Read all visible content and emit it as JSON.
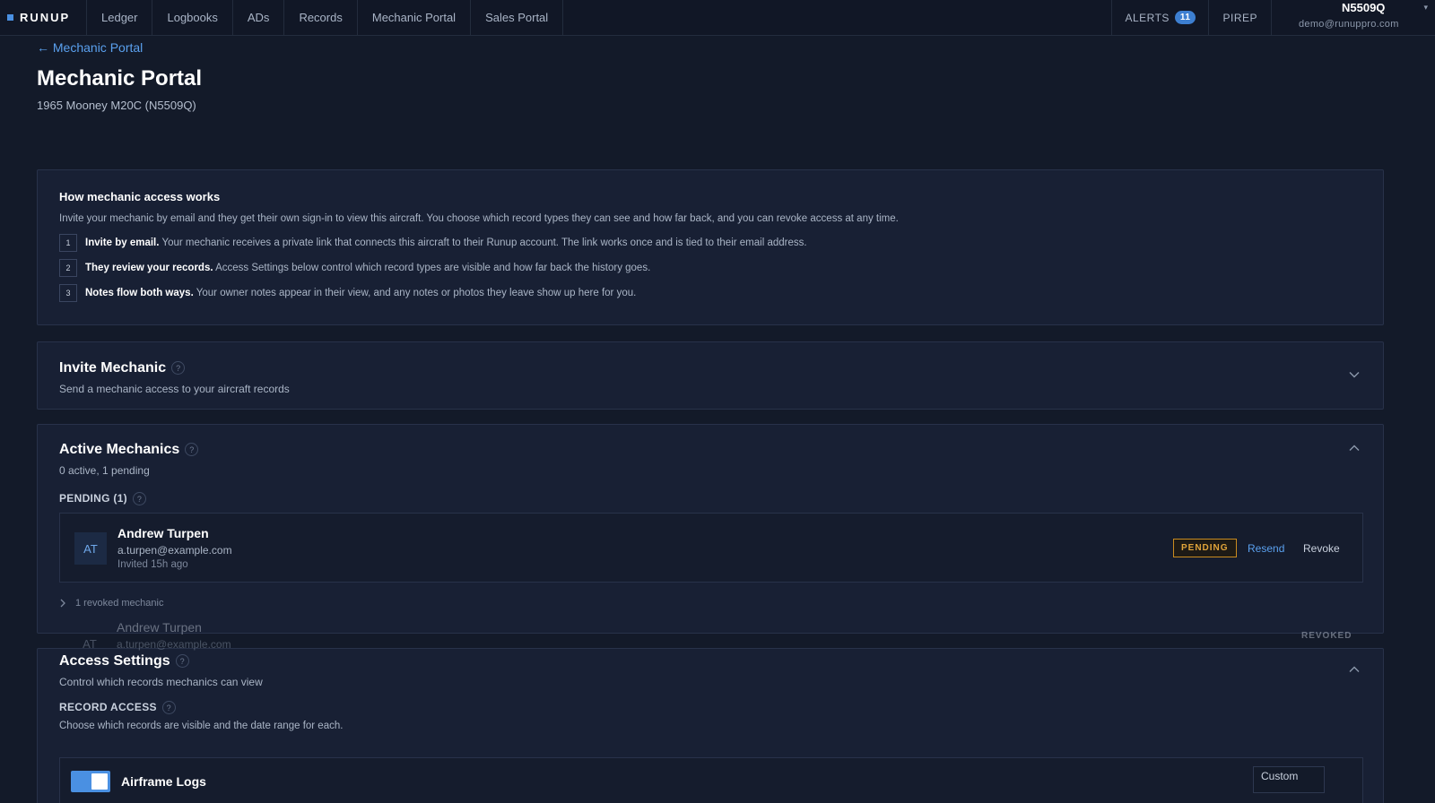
{
  "app": {
    "brand": "RUNUP"
  },
  "nav": {
    "tabs": [
      {
        "label": "Ledger"
      },
      {
        "label": "Logbooks"
      },
      {
        "label": "ADs"
      },
      {
        "label": "Records"
      },
      {
        "label": "Mechanic Portal"
      },
      {
        "label": "Sales Portal"
      }
    ],
    "alerts_label": "ALERTS",
    "alerts_count": "11",
    "pirep_label": "PIREP",
    "account": {
      "tail": "N5509Q",
      "email": "demo@runuppro.com"
    }
  },
  "header": {
    "back_link": "← Mechanic Portal",
    "title": "Mechanic Portal",
    "subtitle": "1965 Mooney M20C (N5509Q)"
  },
  "how_it_works": {
    "title": "How mechanic access works",
    "intro": "Invite your mechanic by email and they get their own sign-in to view this aircraft. You choose which record types they can see and how far back, and you can revoke access at any time.",
    "steps": [
      {
        "num": "1",
        "bold": "Invite by email.",
        "text": "Your mechanic receives a private link that connects this aircraft to their Runup account. The link works once and is tied to their email address."
      },
      {
        "num": "2",
        "bold": "They review your records.",
        "text": "Access Settings below control which record types are visible and how far back the history goes."
      },
      {
        "num": "3",
        "bold": "Notes flow both ways.",
        "text": "Your owner notes appear in their view, and any notes or photos they leave show up here for you."
      }
    ]
  },
  "invite": {
    "title": "Invite Mechanic",
    "subtitle": "Send a mechanic access to your aircraft records"
  },
  "active": {
    "title": "Active Mechanics",
    "subtitle": "0 active, 1 pending",
    "pending_label": "PENDING (1)",
    "pending": [
      {
        "initials": "AT",
        "name": "Andrew Turpen",
        "email": "a.turpen@example.com",
        "invited": "Invited 15h ago",
        "status": "PENDING",
        "resend": "Resend",
        "revoke": "Revoke"
      }
    ],
    "revoked_toggle": "1 revoked mechanic",
    "revoked": [
      {
        "initials": "AT",
        "name": "Andrew Turpen",
        "email": "a.turpen@example.com",
        "status": "REVOKED"
      }
    ]
  },
  "access": {
    "title": "Access Settings",
    "subtitle": "Control which records mechanics can view",
    "record_access_label": "RECORD ACCESS",
    "record_access_sub": "Choose which records are visible and the date range for each.",
    "records": [
      {
        "name": "Airframe Logs",
        "range": "Custom",
        "enabled": true
      }
    ]
  },
  "icons": {
    "help": "help-circle-icon",
    "chevron_down": "chevron-down-icon",
    "chevron_up": "chevron-up-icon",
    "chevron_right": "chevron-right-icon"
  },
  "colors": {
    "background": "#131a29",
    "card": "#182034",
    "accent": "#4a90e2",
    "link": "#5aa0ee",
    "pending": "#e0a43a"
  }
}
